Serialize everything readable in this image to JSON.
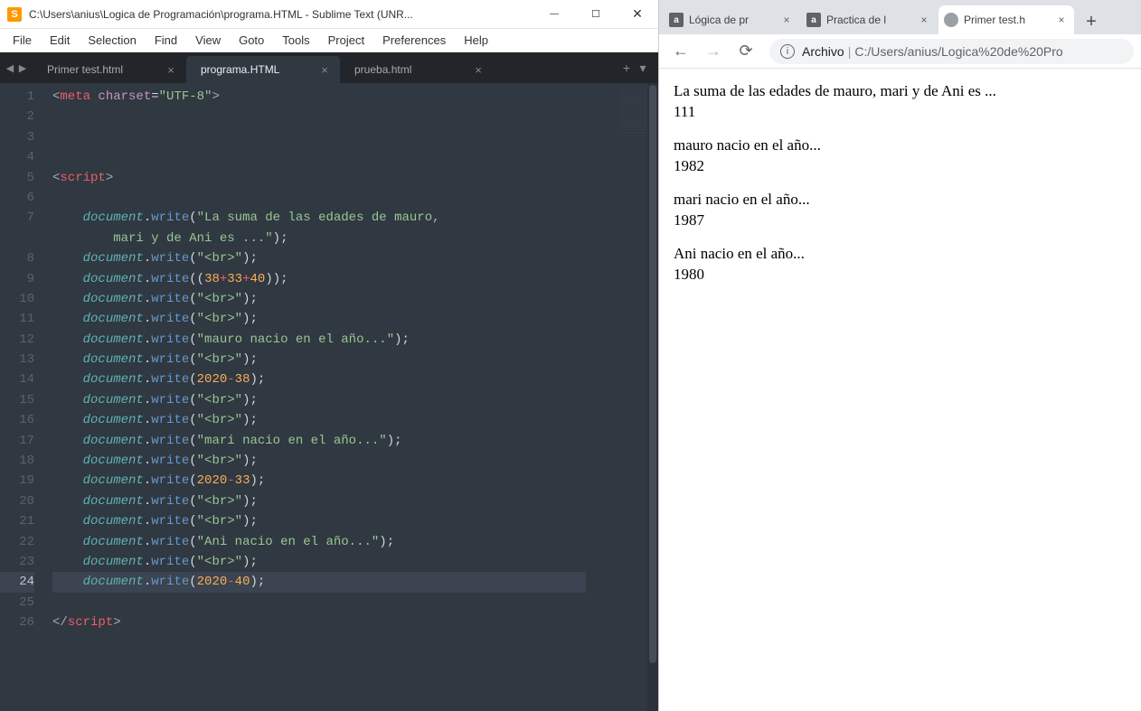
{
  "sublime": {
    "title": "C:\\Users\\anius\\Logica de Programación\\programa.HTML - Sublime Text (UNR...",
    "menu": [
      "File",
      "Edit",
      "Selection",
      "Find",
      "View",
      "Goto",
      "Tools",
      "Project",
      "Preferences",
      "Help"
    ],
    "tabs": [
      {
        "label": "Primer test.html",
        "active": false
      },
      {
        "label": "programa.HTML",
        "active": true
      },
      {
        "label": "prueba.html",
        "active": false
      }
    ],
    "gutter": [
      "1",
      "2",
      "3",
      "4",
      "5",
      "6",
      "7",
      "8",
      "9",
      "10",
      "11",
      "12",
      "13",
      "14",
      "15",
      "16",
      "17",
      "18",
      "19",
      "20",
      "21",
      "22",
      "23",
      "24",
      "25",
      "26"
    ],
    "activeLine": 24,
    "code": {
      "t_meta": "meta",
      "a_charset": "charset",
      "v_utf8": "\"UTF-8\"",
      "t_script": "script",
      "t_script_close": "script",
      "obj": "document",
      "method": "write",
      "s_suma": "\"La suma de las edades de mauro, ",
      "s_suma_wrap": "mari y de Ani es ...\"",
      "s_br": "\"<br>\"",
      "n38": "38",
      "n33": "33",
      "n40": "40",
      "s_mauro": "\"mauro nacio en el año...\"",
      "n2020": "2020",
      "s_mari": "\"mari nacio en el año...\"",
      "s_ani": "\"Ani nacio en el año...\""
    }
  },
  "chrome": {
    "tabs": [
      {
        "label": "Lógica de pr",
        "favicon": "a",
        "type": "a"
      },
      {
        "label": "Practica de l",
        "favicon": "a",
        "type": "a"
      },
      {
        "label": "Primer test.h",
        "favicon": "",
        "type": "globe",
        "active": true
      }
    ],
    "omnibox": {
      "scheme": "Archivo",
      "path": "C:/Users/anius/Logica%20de%20Pro"
    },
    "content": {
      "p1_label": "La suma de las edades de mauro, mari y de Ani es ...",
      "p1_value": "111",
      "p2_label": "mauro nacio en el año...",
      "p2_value": "1982",
      "p3_label": "mari nacio en el año...",
      "p3_value": "1987",
      "p4_label": "Ani nacio en el año...",
      "p4_value": "1980"
    }
  }
}
